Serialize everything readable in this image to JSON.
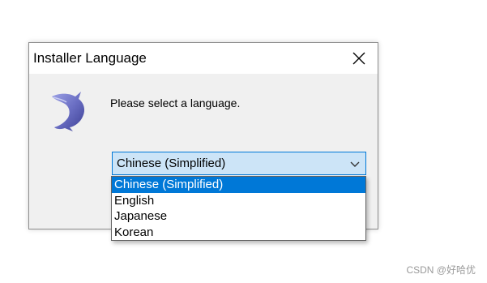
{
  "window": {
    "title": "Installer Language",
    "close_icon": "close-icon"
  },
  "dialog": {
    "prompt": "Please select a language.",
    "app_icon": "dolphin-icon"
  },
  "language_select": {
    "selected": "Chinese (Simplified)",
    "arrow_icon": "chevron-down-icon",
    "options": [
      "Chinese (Simplified)",
      "English",
      "Japanese",
      "Korean"
    ],
    "highlighted_index": 0
  },
  "watermark": "CSDN @好哈优",
  "colors": {
    "accent": "#0078d7",
    "combo_bg": "#cce4f7",
    "dialog_bg": "#f0f0f0",
    "icon_color": "#6b6fc4"
  }
}
